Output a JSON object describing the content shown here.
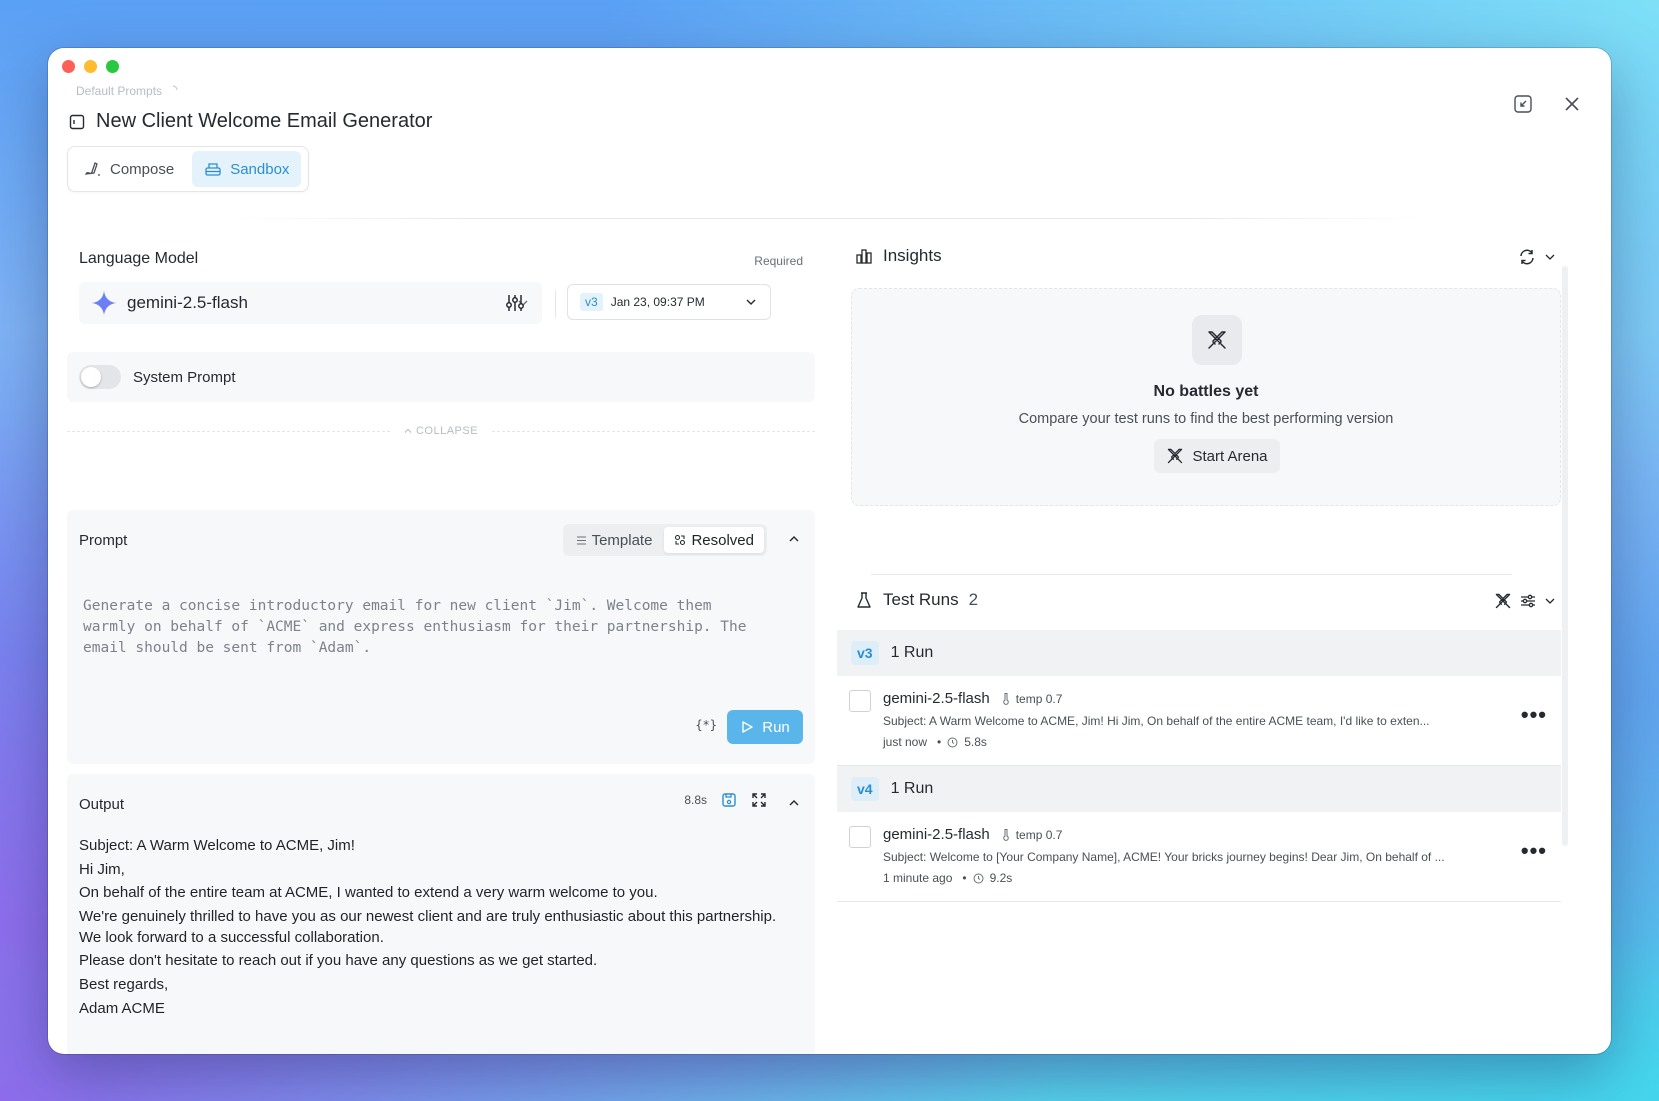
{
  "window": {
    "breadcrumb": "Default Prompts",
    "title": "New Client Welcome Email Generator"
  },
  "mode_tabs": [
    {
      "label": "Compose",
      "active": false
    },
    {
      "label": "Sandbox",
      "active": true
    }
  ],
  "model_section": {
    "label": "Language Model",
    "required": "Required",
    "model": "gemini-2.5-flash",
    "version_badge": "v3",
    "version_date": "Jan 23, 09:37 PM"
  },
  "system_prompt": {
    "label": "System Prompt",
    "enabled": false
  },
  "collapse_label": "COLLAPSE",
  "prompt": {
    "title": "Prompt",
    "segments": [
      "Template",
      "Resolved"
    ],
    "active_segment": "Resolved",
    "text": "Generate a concise introductory email for new client `Jim`. Welcome them\nwarmly on behalf of `ACME` and express enthusiasm for their partnership. The\nemail should be sent from `Adam`.",
    "variables_label": "{*}",
    "run_label": "Run"
  },
  "output": {
    "title": "Output",
    "duration": "8.8s",
    "lines": [
      "Subject: A Warm Welcome to ACME, Jim!",
      "Hi Jim,",
      "On behalf of the entire team at ACME, I wanted to extend a very warm welcome to you.",
      "We're genuinely thrilled to have you as our newest client and are truly enthusiastic about this partnership. We look forward to a successful collaboration.",
      "Please don't hesitate to reach out if you have any questions as we get started.",
      "Best regards,",
      "Adam ACME"
    ]
  },
  "insights": {
    "title": "Insights",
    "empty_title": "No battles yet",
    "empty_subtitle": "Compare your test runs to find the best performing version",
    "arena_label": "Start Arena"
  },
  "test_runs": {
    "title": "Test Runs",
    "count": "2",
    "groups": [
      {
        "version": "v3",
        "runs_label": "1 Run",
        "run": {
          "model": "gemini-2.5-flash",
          "temp": "temp 0.7",
          "summary": "Subject: A Warm Welcome to ACME, Jim! Hi Jim, On behalf of the entire ACME team, I'd like to exten...",
          "when": "just now",
          "duration": "5.8s"
        }
      },
      {
        "version": "v4",
        "runs_label": "1 Run",
        "run": {
          "model": "gemini-2.5-flash",
          "temp": "temp 0.7",
          "summary": "Subject: Welcome to [Your Company Name], ACME! Your bricks journey begins! Dear Jim, On behalf of ...",
          "when": "1 minute ago",
          "duration": "9.2s"
        }
      }
    ]
  },
  "colors": {
    "accent": "#2a8fd0",
    "run_button": "#5ab6ea",
    "panel_bg": "#f7f8f9"
  }
}
